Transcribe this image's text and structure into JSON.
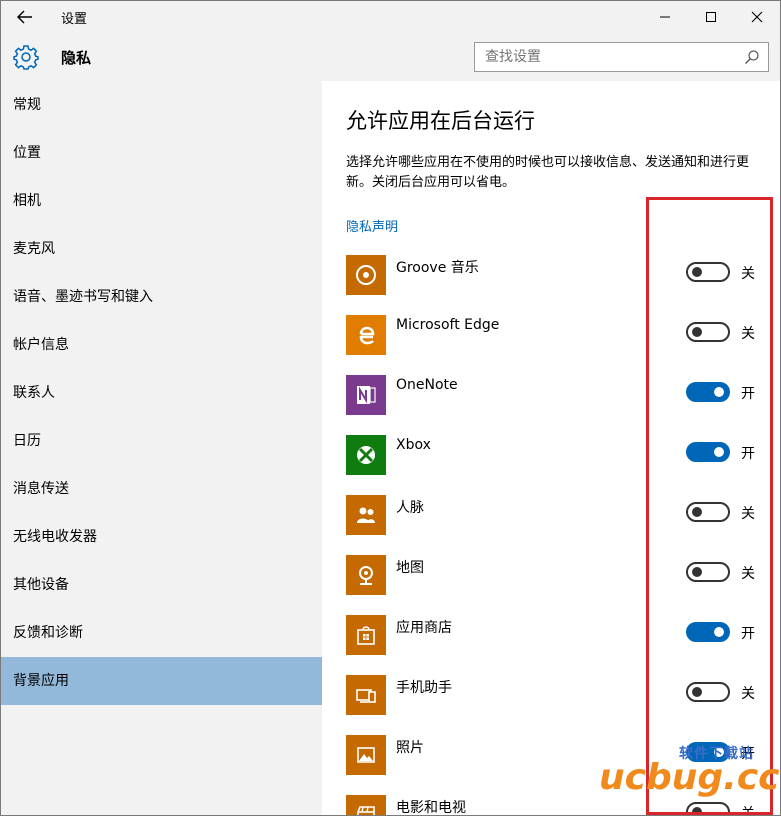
{
  "titlebar": {
    "title": "设置"
  },
  "header": {
    "title": "隐私"
  },
  "search": {
    "placeholder": "查找设置"
  },
  "sidebar": {
    "items": [
      {
        "label": "常规"
      },
      {
        "label": "位置"
      },
      {
        "label": "相机"
      },
      {
        "label": "麦克风"
      },
      {
        "label": "语音、墨迹书写和键入"
      },
      {
        "label": "帐户信息"
      },
      {
        "label": "联系人"
      },
      {
        "label": "日历"
      },
      {
        "label": "消息传送"
      },
      {
        "label": "无线电收发器"
      },
      {
        "label": "其他设备"
      },
      {
        "label": "反馈和诊断"
      },
      {
        "label": "背景应用"
      }
    ],
    "active_index": 12
  },
  "content": {
    "title": "允许应用在后台运行",
    "description": "选择允许哪些应用在不使用的时候也可以接收信息、发送通知和进行更新。关闭后台应用可以省电。",
    "privacy_link": "隐私声明",
    "apps": [
      {
        "name": "Groove 音乐",
        "on": false,
        "state_label": "关",
        "tile_color": "#c46a00",
        "icon": "groove-music-icon"
      },
      {
        "name": "Microsoft Edge",
        "on": false,
        "state_label": "关",
        "tile_color": "#e07c00",
        "icon": "edge-icon"
      },
      {
        "name": "OneNote",
        "on": true,
        "state_label": "开",
        "tile_color": "#7a3b8f",
        "icon": "onenote-icon"
      },
      {
        "name": "Xbox",
        "on": true,
        "state_label": "开",
        "tile_color": "#107c10",
        "icon": "xbox-icon"
      },
      {
        "name": "人脉",
        "on": false,
        "state_label": "关",
        "tile_color": "#c46a00",
        "icon": "people-icon"
      },
      {
        "name": "地图",
        "on": false,
        "state_label": "关",
        "tile_color": "#c46a00",
        "icon": "maps-icon"
      },
      {
        "name": "应用商店",
        "on": true,
        "state_label": "开",
        "tile_color": "#c46a00",
        "icon": "store-icon"
      },
      {
        "name": "手机助手",
        "on": false,
        "state_label": "关",
        "tile_color": "#c46a00",
        "icon": "phone-companion-icon"
      },
      {
        "name": "照片",
        "on": true,
        "state_label": "开",
        "tile_color": "#c46a00",
        "icon": "photos-icon"
      },
      {
        "name": "电影和电视",
        "on": false,
        "state_label": "关",
        "tile_color": "#c46a00",
        "icon": "movies-tv-icon"
      }
    ]
  },
  "watermark": {
    "top_text": "软件下载站",
    "main_text": "ucbug.cc"
  },
  "colors": {
    "accent": "#0067b8",
    "highlight_border": "#d9262b",
    "sidebar_bg": "#f2f2f2",
    "active_item_bg": "#92b9da"
  }
}
